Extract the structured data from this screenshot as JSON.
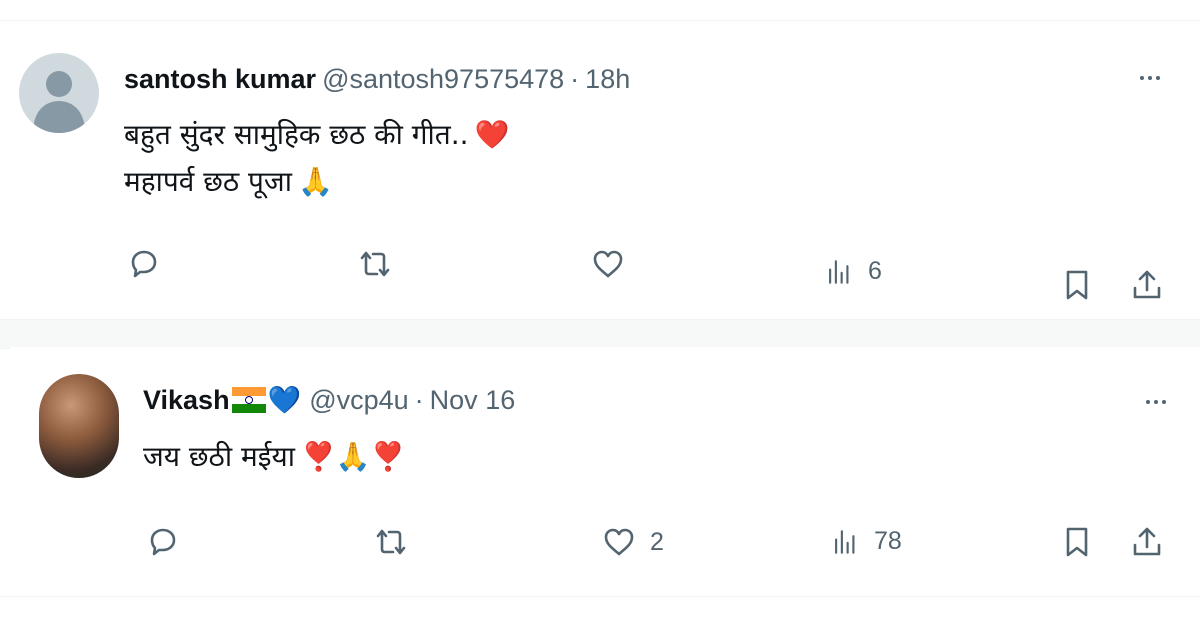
{
  "posts": [
    {
      "author": {
        "name": "santosh kumar",
        "handle": "@santosh97575478",
        "separator": "·",
        "time": "18h"
      },
      "text_lines": [
        "बहुत सुंदर सामुहिक छठ की गीत..",
        "महापर्व छठ पूजा"
      ],
      "line_emojis": [
        "❤️",
        "🙏"
      ],
      "actions": {
        "reply_count": "",
        "repost_count": "",
        "like_count": "",
        "views_count": "6"
      }
    },
    {
      "author": {
        "name": "Vikash",
        "handle": "@vcp4u",
        "separator": "·",
        "time": "Nov 16",
        "name_emoji": "💙"
      },
      "text_lines": [
        "जय छठी मईया "
      ],
      "line_emojis": [
        "❣️🙏❣️"
      ],
      "actions": {
        "reply_count": "",
        "repost_count": "",
        "like_count": "2",
        "views_count": "78"
      }
    }
  ],
  "icons": {
    "reply": "reply-icon",
    "repost": "repost-icon",
    "like": "heart-icon",
    "views": "views-icon",
    "bookmark": "bookmark-icon",
    "share": "share-icon",
    "more": "more-icon"
  },
  "colors": {
    "text_primary": "#0f1419",
    "text_secondary": "#536471",
    "divider": "#eff3f4",
    "avatar_default": "#cfd9de"
  }
}
